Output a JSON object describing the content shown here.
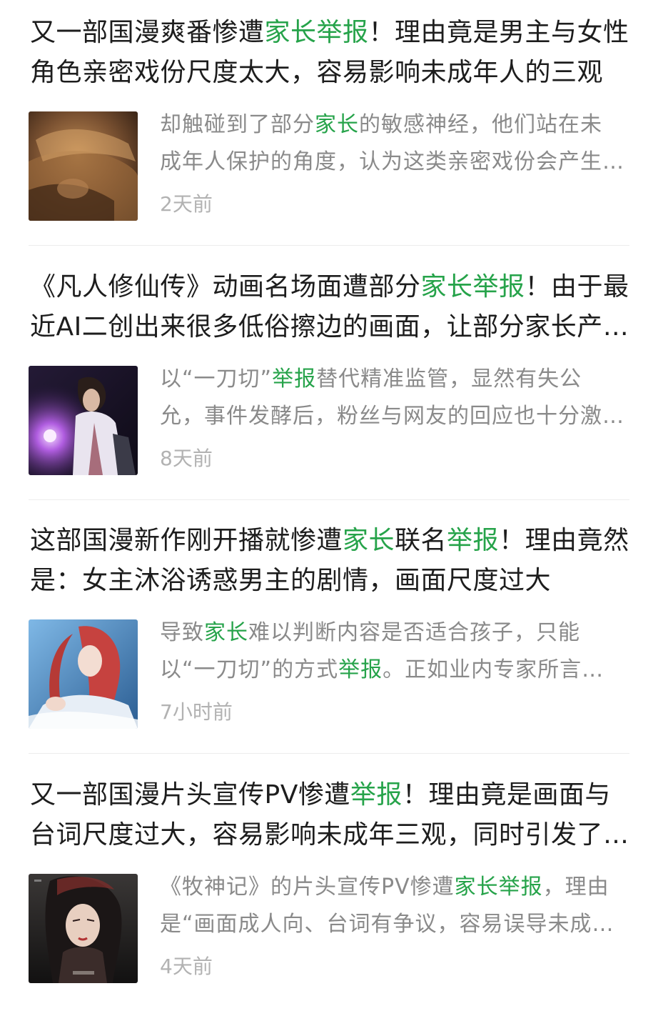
{
  "accent_color": "#26a34a",
  "results": [
    {
      "title_parts": [
        {
          "t": "又一部国漫爽番惨遭",
          "hl": false
        },
        {
          "t": "家长举报",
          "hl": true
        },
        {
          "t": "！理由竟是男主与女性角色亲密戏份尺度太大，容易影响未成年人的三观",
          "hl": false
        }
      ],
      "snippet_parts": [
        {
          "t": "却触碰到了部分",
          "hl": false
        },
        {
          "t": "家长",
          "hl": true
        },
        {
          "t": "的敏感神经，他们站在未成年人保护的角度，认为这类亲密戏份会产生不良影响",
          "hl": false
        }
      ],
      "time": "2天前",
      "thumb_icon": "anime-intimate-scene-thumbnail"
    },
    {
      "title_parts": [
        {
          "t": "《凡人修仙传》动画名场面遭部分",
          "hl": false
        },
        {
          "t": "家长举报",
          "hl": true
        },
        {
          "t": "！由于最近AI二创出来很多低俗擦边的画面，让部分家长产生了误解",
          "hl": false
        }
      ],
      "snippet_parts": [
        {
          "t": "以“一刀切”",
          "hl": false
        },
        {
          "t": "举报",
          "hl": true
        },
        {
          "t": "替代精准监管，显然有失公允，事件发酵后，粉丝与网友的回应也十分激烈",
          "hl": false
        }
      ],
      "time": "8天前",
      "thumb_icon": "cultivator-purple-magic-thumbnail"
    },
    {
      "title_parts": [
        {
          "t": "这部国漫新作刚开播就惨遭",
          "hl": false
        },
        {
          "t": "家长",
          "hl": true
        },
        {
          "t": "联名",
          "hl": false
        },
        {
          "t": "举报",
          "hl": true
        },
        {
          "t": "！理由竟然是：女主沐浴诱惑男主的剧情，画面尺度过大",
          "hl": false
        }
      ],
      "snippet_parts": [
        {
          "t": "导致",
          "hl": false
        },
        {
          "t": "家长",
          "hl": true
        },
        {
          "t": "难以判断内容是否适合孩子，只能以“一刀切”的方式",
          "hl": false
        },
        {
          "t": "举报",
          "hl": true
        },
        {
          "t": "。正如业内专家所言，分级制度尚不完善",
          "hl": false
        }
      ],
      "time": "7小时前",
      "thumb_icon": "red-haired-heroine-bath-thumbnail"
    },
    {
      "title_parts": [
        {
          "t": "又一部国漫片头宣传PV惨遭",
          "hl": false
        },
        {
          "t": "举报",
          "hl": true
        },
        {
          "t": "！理由竟是画面与台词尺度过大，容易影响未成年三观，同时引发了热议",
          "hl": false
        }
      ],
      "snippet_parts": [
        {
          "t": "《牧神记》的片头宣传PV惨遭",
          "hl": false
        },
        {
          "t": "家长举报",
          "hl": true
        },
        {
          "t": "，理由是“画面成人向、台词有争议，容易误导未成年人”",
          "hl": false
        }
      ],
      "time": "4天前",
      "thumb_icon": "dark-haired-woman-pv-thumbnail"
    }
  ]
}
